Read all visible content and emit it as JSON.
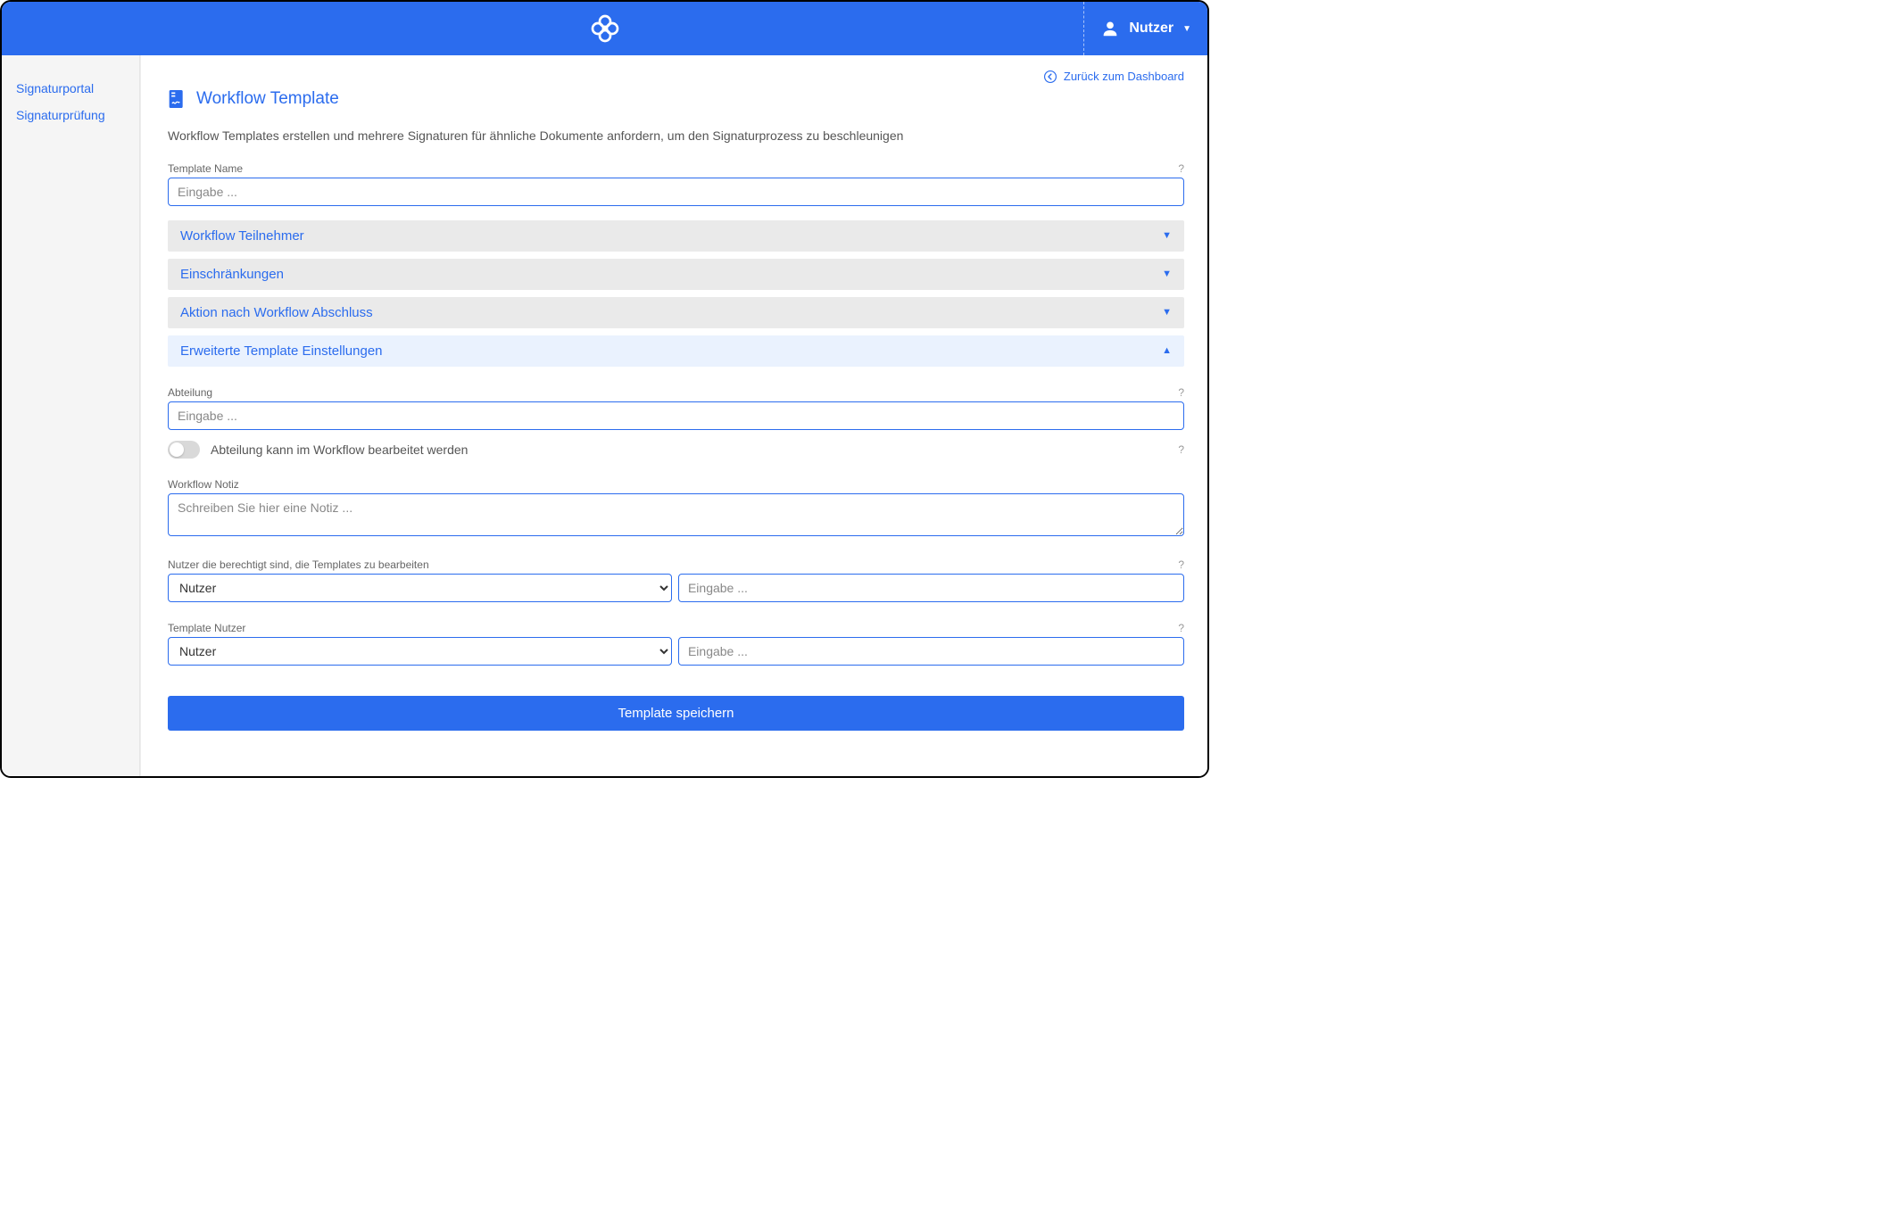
{
  "header": {
    "user_label": "Nutzer"
  },
  "sidebar": {
    "items": [
      {
        "label": "Signaturportal"
      },
      {
        "label": "Signaturprüfung"
      }
    ]
  },
  "back_link": "Zurück zum Dashboard",
  "page": {
    "title": "Workflow Template",
    "subtitle": "Workflow Templates erstellen und mehrere Signaturen für ähnliche Dokumente anfordern, um den Signaturprozess zu beschleunigen"
  },
  "fields": {
    "template_name": {
      "label": "Template Name",
      "placeholder": "Eingabe ...",
      "help": "?"
    },
    "abteilung": {
      "label": "Abteilung",
      "placeholder": "Eingabe ...",
      "help": "?"
    },
    "abteilung_toggle": {
      "label": "Abteilung kann im Workflow bearbeitet werden",
      "help": "?"
    },
    "workflow_notiz": {
      "label": "Workflow Notiz",
      "placeholder": "Schreiben Sie hier eine Notiz ..."
    },
    "permitted_users": {
      "label": "Nutzer die berechtigt sind, die Templates zu bearbeiten",
      "placeholder": "Eingabe ...",
      "help": "?"
    },
    "template_users": {
      "label": "Template Nutzer",
      "placeholder": "Eingabe ...",
      "help": "?"
    }
  },
  "accordions": [
    {
      "title": "Workflow Teilnehmer",
      "expanded": false
    },
    {
      "title": "Einschränkungen",
      "expanded": false
    },
    {
      "title": "Aktion nach Workflow Abschluss",
      "expanded": false
    },
    {
      "title": "Erweiterte Template Einstellungen",
      "expanded": true
    }
  ],
  "select_options": {
    "user_type": "Nutzer"
  },
  "buttons": {
    "save": "Template speichern"
  }
}
